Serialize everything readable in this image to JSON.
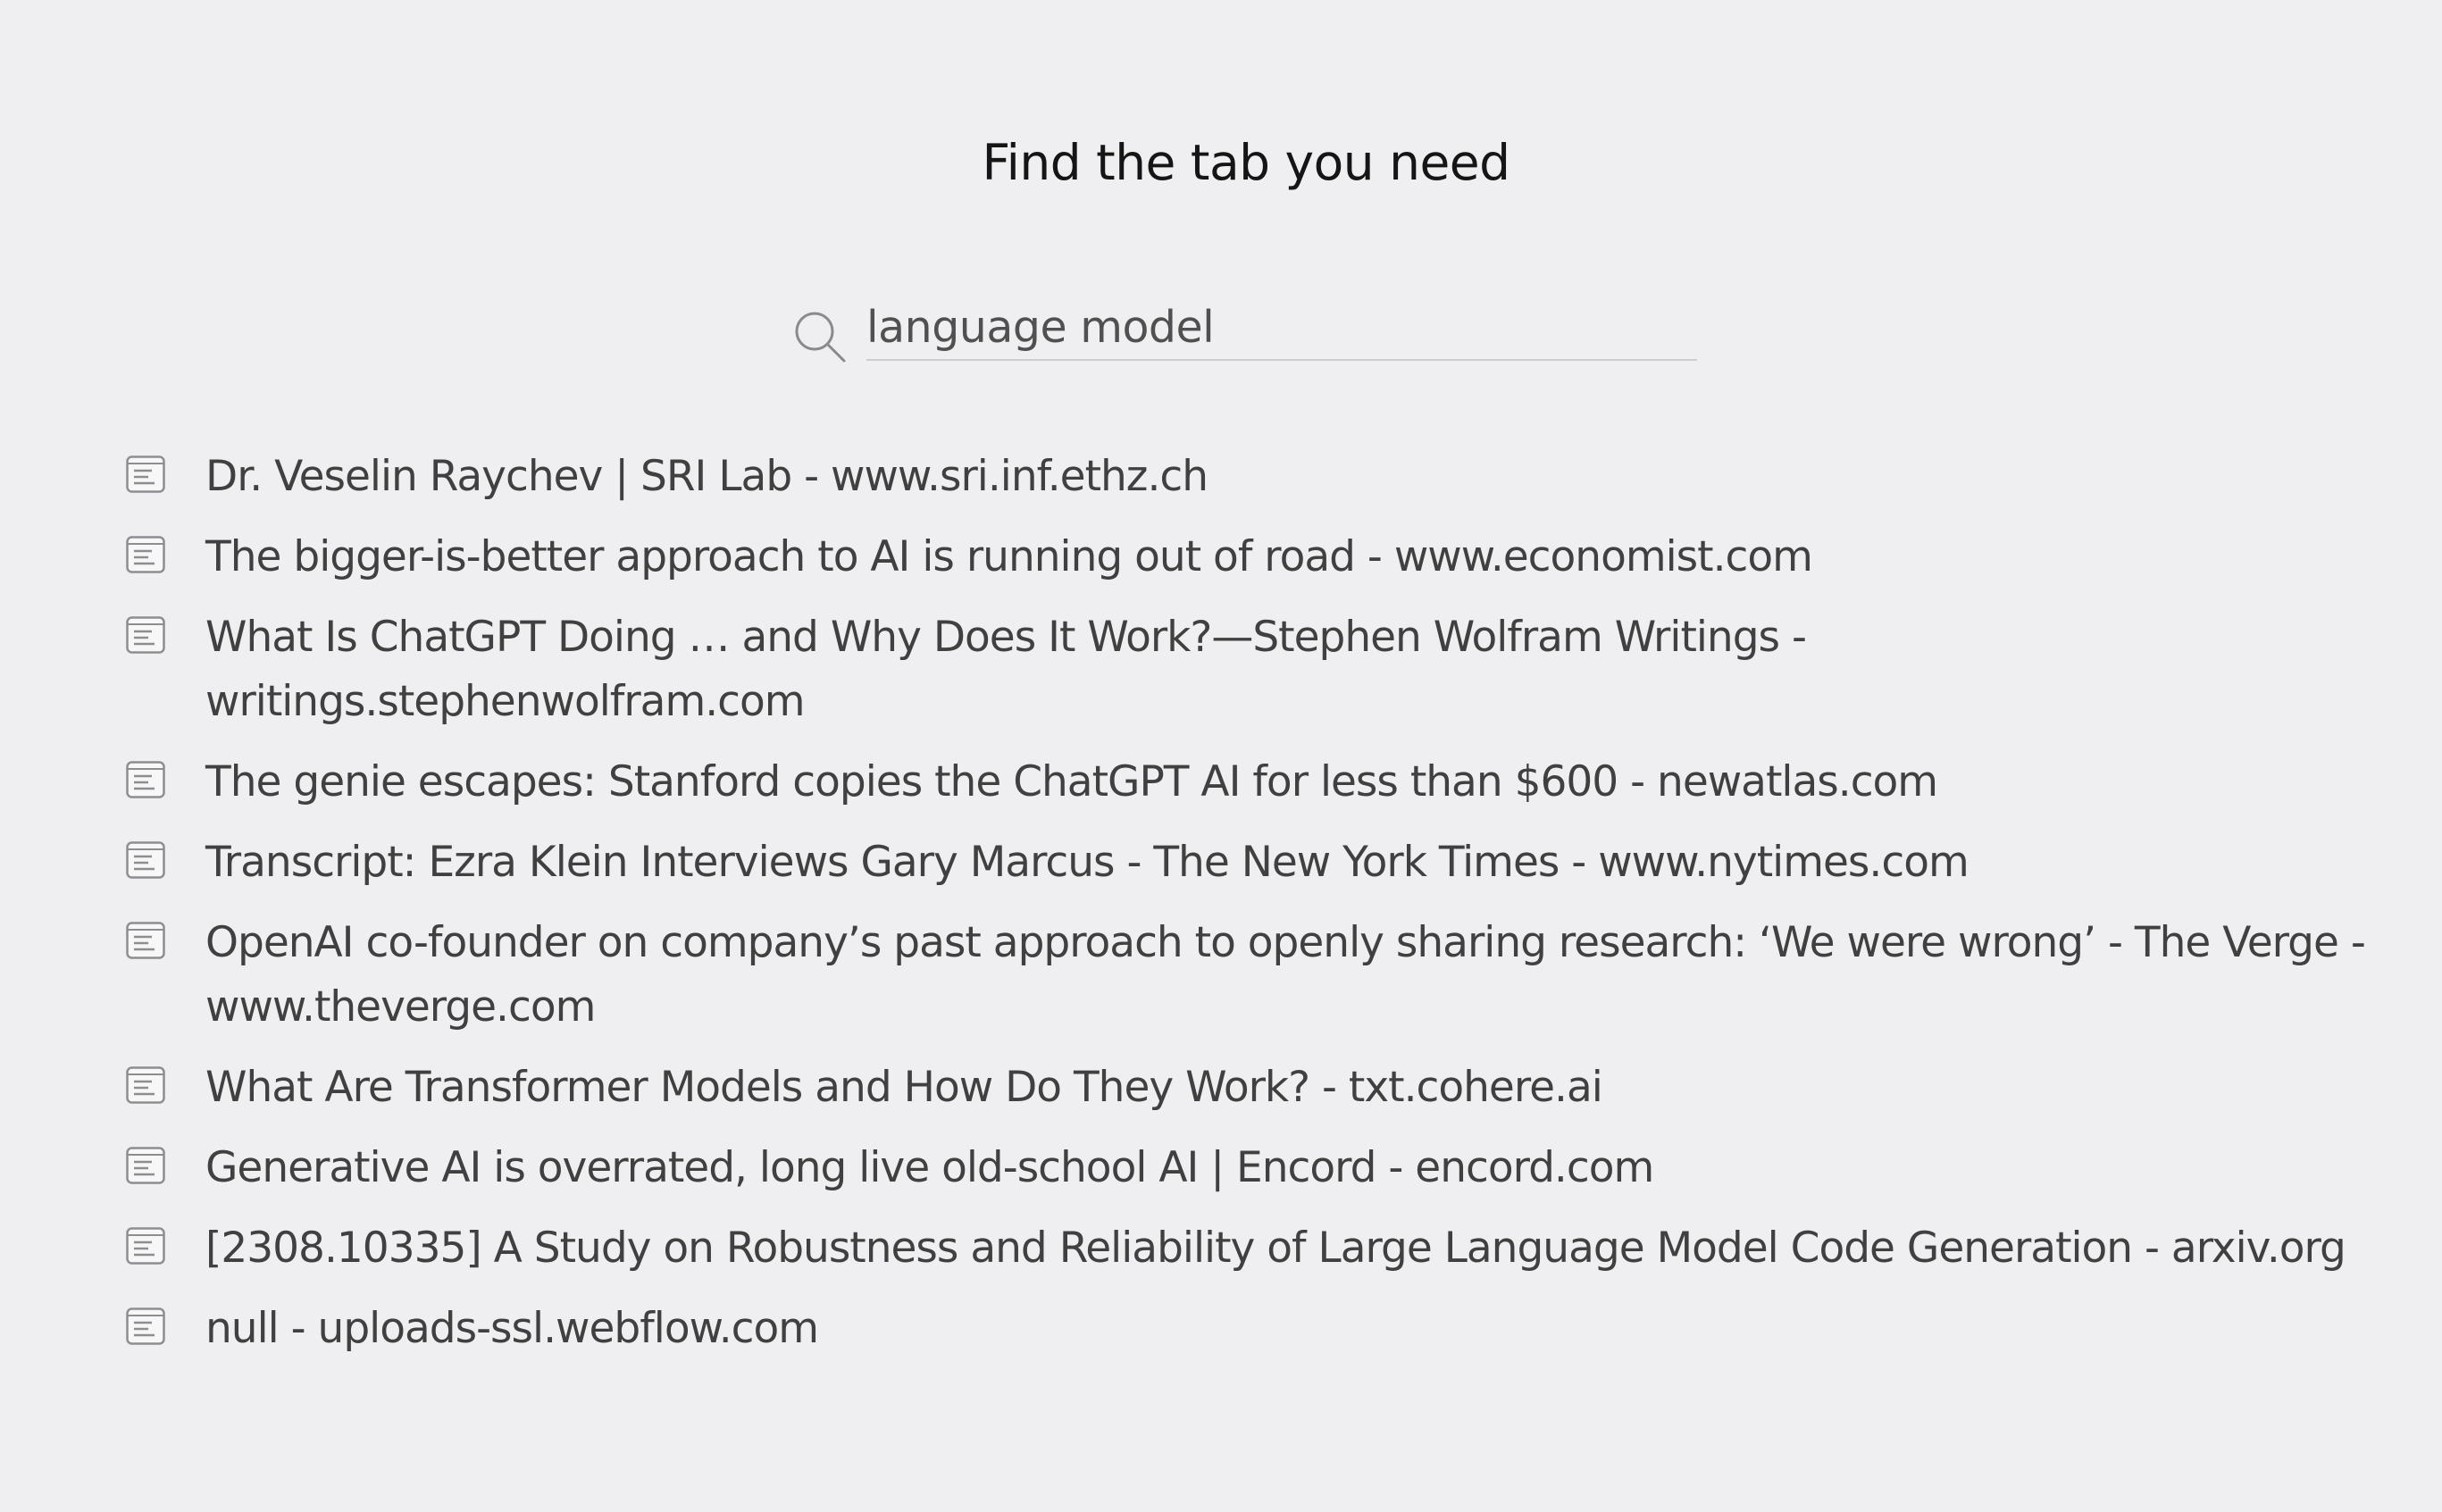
{
  "header": {
    "title": "Find the tab you need"
  },
  "search": {
    "icon": "search-icon",
    "value": "language model",
    "placeholder": ""
  },
  "results": [
    {
      "icon": "tab-page-icon",
      "title": "Dr. Veselin Raychev | SRI Lab - www.sri.inf.ethz.ch"
    },
    {
      "icon": "tab-page-icon",
      "title": "The bigger-is-better approach to AI is running out of road - www.economist.com"
    },
    {
      "icon": "tab-page-icon",
      "title": "What Is ChatGPT Doing … and Why Does It Work?—Stephen Wolfram Writings - writings.stephenwolfram.com"
    },
    {
      "icon": "tab-page-icon",
      "title": "The genie escapes: Stanford copies the ChatGPT AI for less than $600 - newatlas.com"
    },
    {
      "icon": "tab-page-icon",
      "title": "Transcript: Ezra Klein Interviews Gary Marcus - The New York Times - www.nytimes.com"
    },
    {
      "icon": "tab-page-icon",
      "title": "OpenAI co-founder on company’s past approach to openly sharing research: ‘We were wrong’ - The Verge - www.theverge.com"
    },
    {
      "icon": "tab-page-icon",
      "title": "What Are Transformer Models and How Do They Work? - txt.cohere.ai"
    },
    {
      "icon": "tab-page-icon",
      "title": "Generative AI is overrated, long live old-school AI | Encord - encord.com"
    },
    {
      "icon": "tab-page-icon",
      "title": "[2308.10335] A Study on Robustness and Reliability of Large Language Model Code Generation - arxiv.org"
    },
    {
      "icon": "tab-page-icon",
      "title": "null - uploads-ssl.webflow.com"
    }
  ]
}
